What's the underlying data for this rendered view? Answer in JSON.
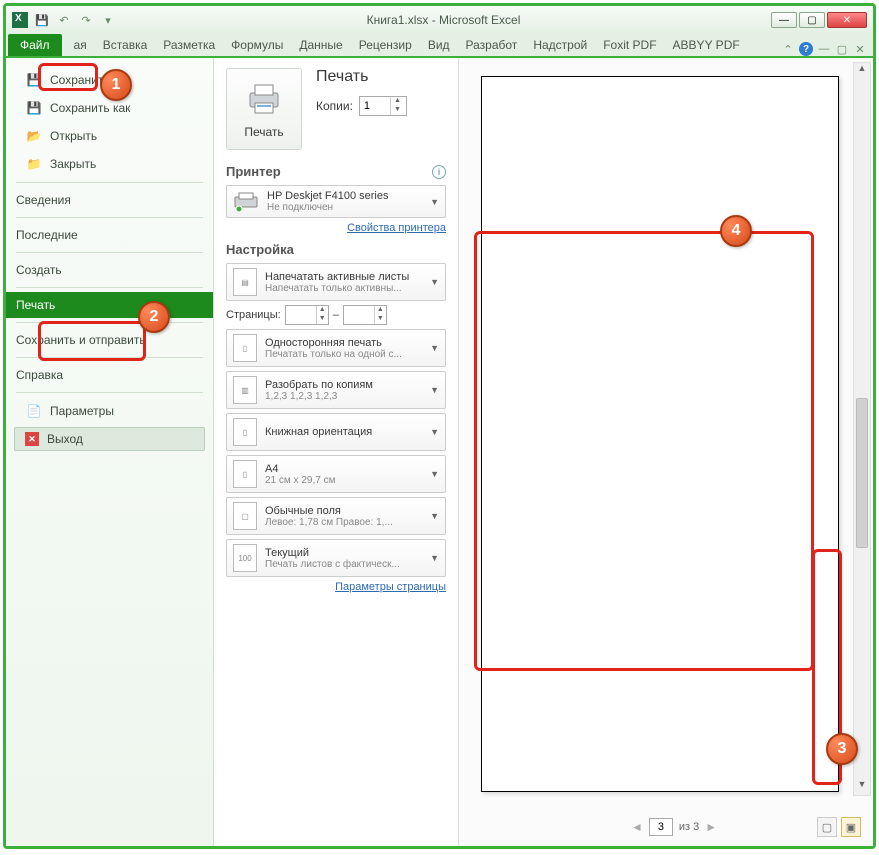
{
  "window": {
    "title": "Книга1.xlsx - Microsoft Excel"
  },
  "ribbon": {
    "file": "Файл",
    "tabs": [
      "ая",
      "Вставка",
      "Разметка",
      "Формулы",
      "Данные",
      "Рецензир",
      "Вид",
      "Разработ",
      "Надстрой",
      "Foxit PDF",
      "ABBYY PDF"
    ]
  },
  "nav": {
    "save": "Сохранить",
    "saveas": "Сохранить как",
    "open": "Открыть",
    "close": "Закрыть",
    "info": "Сведения",
    "recent": "Последние",
    "new": "Создать",
    "print": "Печать",
    "sendshare": "Сохранить и отправить",
    "help": "Справка",
    "options": "Параметры",
    "exit": "Выход"
  },
  "print": {
    "heading": "Печать",
    "print_btn": "Печать",
    "copies_label": "Копии:",
    "copies_value": "1",
    "printer_header": "Принтер",
    "printer_name": "HP Deskjet F4100 series",
    "printer_status": "Не подключен",
    "printer_props": "Свойства принтера",
    "settings_header": "Настройка",
    "opt_active": {
      "t": "Напечатать активные листы",
      "s": "Напечатать только активны..."
    },
    "pages_label": "Страницы:",
    "pages_sep": "–",
    "opt_oneside": {
      "t": "Односторонняя печать",
      "s": "Печатать только на одной с..."
    },
    "opt_collate": {
      "t": "Разобрать по копиям",
      "s": "1,2,3   1,2,3   1,2,3"
    },
    "opt_orient": {
      "t": "Книжная ориентация",
      "s": ""
    },
    "opt_paper": {
      "t": "A4",
      "s": "21 см x 29,7 см"
    },
    "opt_margins": {
      "t": "Обычные поля",
      "s": "Левое: 1,78 см   Правое: 1,..."
    },
    "opt_scale": {
      "t": "Текущий",
      "s": "Печать листов с фактическ..."
    },
    "page_setup": "Параметры страницы"
  },
  "preview": {
    "page_current": "3",
    "page_of": "из 3"
  },
  "callouts": {
    "b1": "1",
    "b2": "2",
    "b3": "3",
    "b4": "4"
  }
}
